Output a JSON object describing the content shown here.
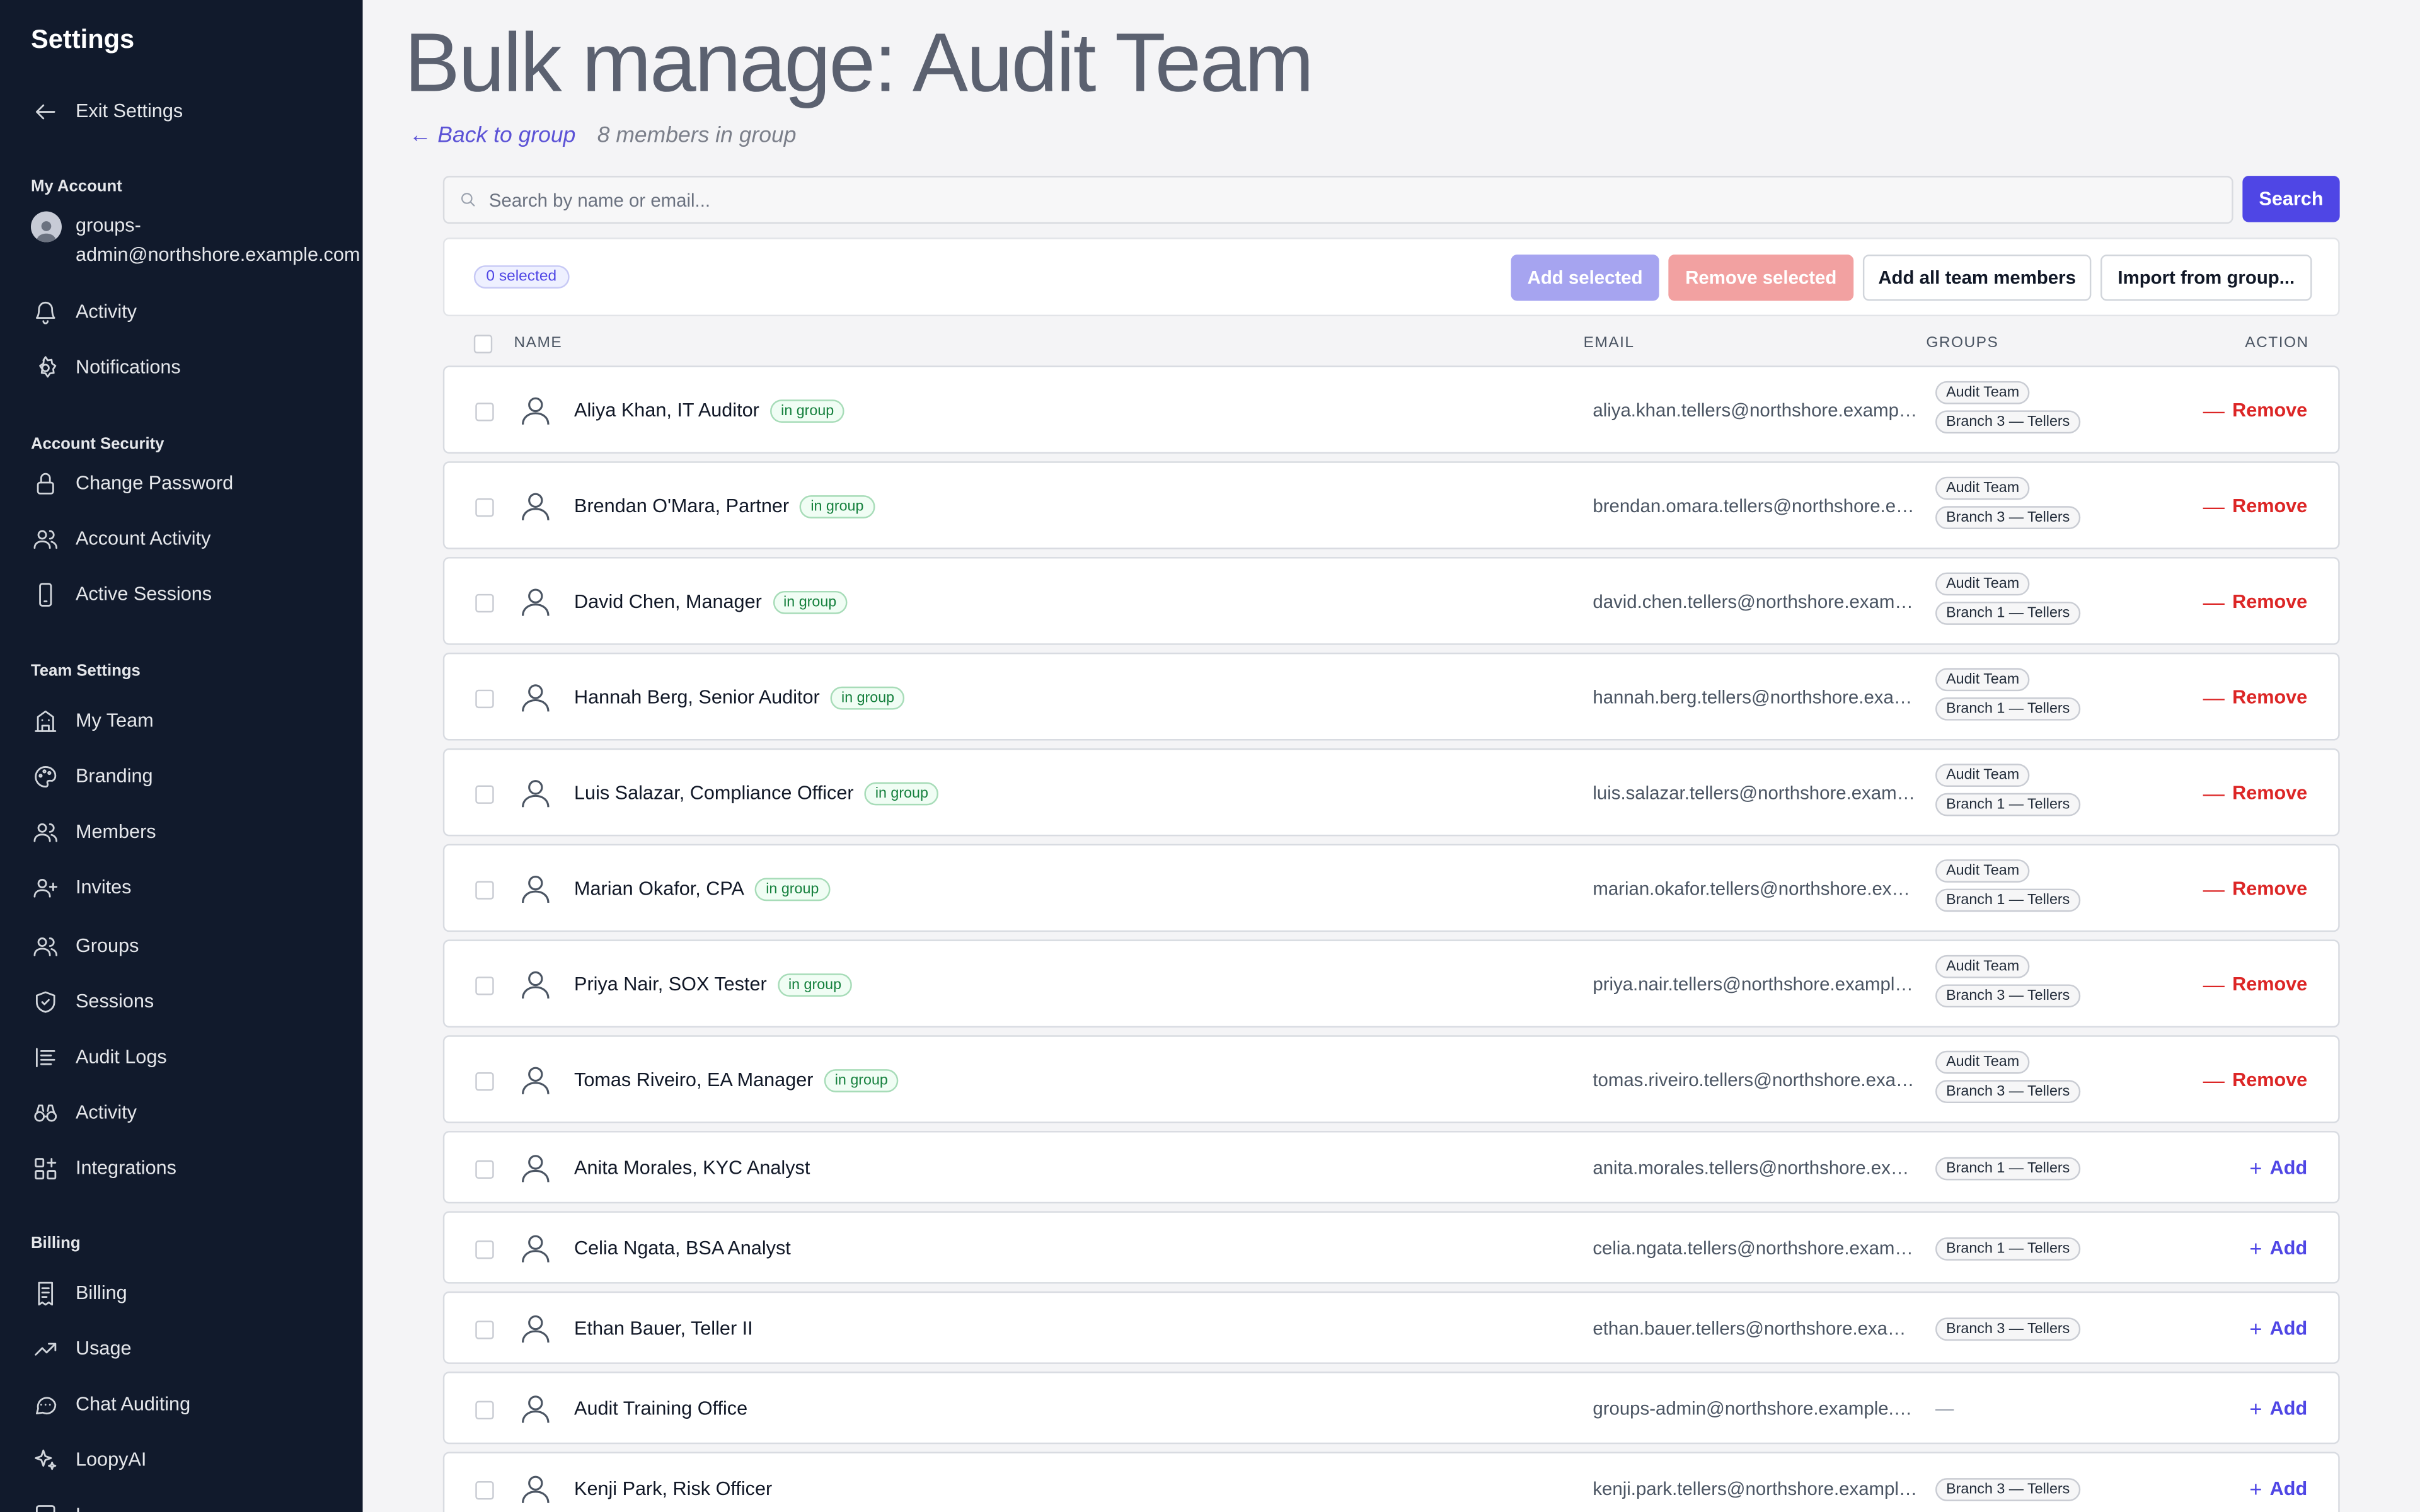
{
  "sidebar": {
    "title": "Settings",
    "exit_label": "Exit Settings",
    "sections": {
      "my_account": "My Account",
      "account_security": "Account Security",
      "team_settings": "Team Settings",
      "billing": "Billing"
    },
    "account_email": "groups-admin@northshore.example.com",
    "items": {
      "activity": "Activity",
      "notifications": "Notifications",
      "change_password": "Change Password",
      "account_activity": "Account Activity",
      "active_sessions": "Active Sessions",
      "my_team": "My Team",
      "branding": "Branding",
      "members": "Members",
      "invites": "Invites",
      "groups": "Groups",
      "sessions": "Sessions",
      "audit_logs": "Audit Logs",
      "team_activity": "Activity",
      "integrations": "Integrations",
      "billing": "Billing",
      "usage": "Usage",
      "chat_auditing": "Chat Auditing",
      "loopyai": "LoopyAI",
      "partial": "L..."
    }
  },
  "page": {
    "title": "Bulk manage: Audit Team",
    "back_label": "Back to group",
    "member_count": "8 members in group"
  },
  "search": {
    "placeholder": "Search by name or email...",
    "button": "Search"
  },
  "toolbar": {
    "selected": "0 selected",
    "add_selected": "Add selected",
    "remove_selected": "Remove selected",
    "add_all": "Add all team members",
    "import": "Import from group..."
  },
  "table": {
    "headers": {
      "name": "NAME",
      "email": "EMAIL",
      "groups": "GROUPS",
      "action": "ACTION"
    },
    "in_group_label": "in group",
    "remove_label": "Remove",
    "add_label": "Add",
    "empty_groups": "—",
    "rows": [
      {
        "name": "Aliya Khan, IT Auditor",
        "email": "aliya.khan.tellers@northshore.example.com",
        "groups": [
          "Audit Team",
          "Branch 3 — Tellers"
        ],
        "in_group": true
      },
      {
        "name": "Brendan O'Mara, Partner",
        "email": "brendan.omara.tellers@northshore.example.com",
        "groups": [
          "Audit Team",
          "Branch 3 — Tellers"
        ],
        "in_group": true
      },
      {
        "name": "David Chen, Manager",
        "email": "david.chen.tellers@northshore.example.com",
        "groups": [
          "Audit Team",
          "Branch 1 — Tellers"
        ],
        "in_group": true
      },
      {
        "name": "Hannah Berg, Senior Auditor",
        "email": "hannah.berg.tellers@northshore.example.com",
        "groups": [
          "Audit Team",
          "Branch 1 — Tellers"
        ],
        "in_group": true
      },
      {
        "name": "Luis Salazar, Compliance Officer",
        "email": "luis.salazar.tellers@northshore.example.com",
        "groups": [
          "Audit Team",
          "Branch 1 — Tellers"
        ],
        "in_group": true
      },
      {
        "name": "Marian Okafor, CPA",
        "email": "marian.okafor.tellers@northshore.example.com",
        "groups": [
          "Audit Team",
          "Branch 1 — Tellers"
        ],
        "in_group": true
      },
      {
        "name": "Priya Nair, SOX Tester",
        "email": "priya.nair.tellers@northshore.example.com",
        "groups": [
          "Audit Team",
          "Branch 3 — Tellers"
        ],
        "in_group": true
      },
      {
        "name": "Tomas Riveiro, EA Manager",
        "email": "tomas.riveiro.tellers@northshore.example.com",
        "groups": [
          "Audit Team",
          "Branch 3 — Tellers"
        ],
        "in_group": true
      },
      {
        "name": "Anita Morales, KYC Analyst",
        "email": "anita.morales.tellers@northshore.example.com",
        "groups": [
          "Branch 1 — Tellers"
        ],
        "in_group": false
      },
      {
        "name": "Celia Ngata, BSA Analyst",
        "email": "celia.ngata.tellers@northshore.example.com",
        "groups": [
          "Branch 1 — Tellers"
        ],
        "in_group": false
      },
      {
        "name": "Ethan Bauer, Teller II",
        "email": "ethan.bauer.tellers@northshore.example.com",
        "groups": [
          "Branch 3 — Tellers"
        ],
        "in_group": false
      },
      {
        "name": "Audit Training Office",
        "email": "groups-admin@northshore.example.com",
        "groups": [],
        "in_group": false
      },
      {
        "name": "Kenji Park, Risk Officer",
        "email": "kenji.park.tellers@northshore.example.com",
        "groups": [
          "Branch 3 — Tellers"
        ],
        "in_group": false
      }
    ]
  }
}
